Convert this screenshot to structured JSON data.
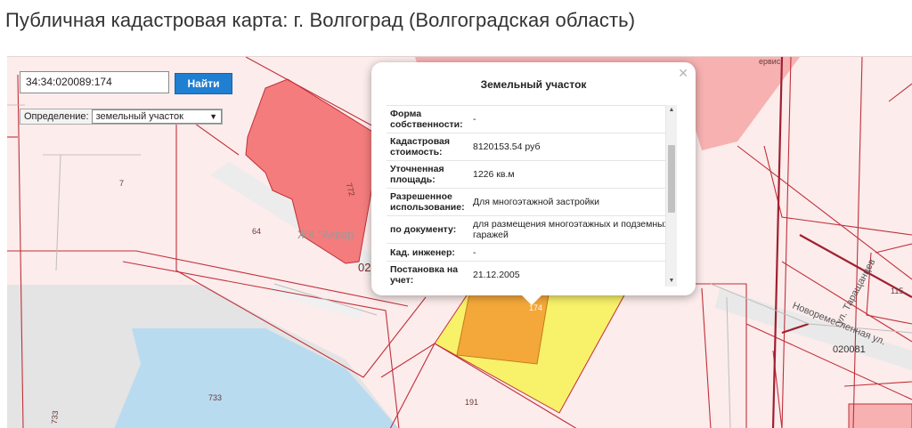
{
  "page": {
    "title": "Публичная кадастровая карта: г. Волгоград (Волгоградская область)"
  },
  "search": {
    "value": "34:34:020089:174",
    "button_label": "Найти"
  },
  "definition": {
    "label": "Определение:",
    "selected": "земельный участок"
  },
  "map_labels": {
    "parcel_7": "7",
    "parcel_772": "772",
    "parcel_64": "64",
    "zhk": "ЖК \"Аквар",
    "quarter_02": "02",
    "parcel_733": "733",
    "parcel_733_b": "733",
    "parcel_191": "191",
    "parcel_174": "174",
    "parcel_115": "115",
    "quarter_020081": "020081",
    "street_tarashchantsev": "ул. Таращанцев",
    "street_novoremeslennaya": "Новоремесленная ул.",
    "top_service": "ервис"
  },
  "popup": {
    "title": "Земельный участок",
    "close_icon": "close-icon",
    "rows": [
      {
        "key": "Форма собственности:",
        "value": "-"
      },
      {
        "key": "Кадастровая стоимость:",
        "value": "8120153.54 руб"
      },
      {
        "key": "Уточненная площадь:",
        "value": "1226 кв.м"
      },
      {
        "key": "Разрешенное использование:",
        "value": "Для многоэтажной застройки"
      },
      {
        "key": "по документу:",
        "value": "для размещения многоэтажных и подземных гаражей"
      },
      {
        "key": "Кад. инженер:",
        "value": "-"
      },
      {
        "key": "Постановка на учет:",
        "value": "21.12.2005"
      }
    ]
  },
  "colors": {
    "parcel_fill": "#fcecec",
    "boundary": "#c0303a",
    "building_red": "#f47c7c",
    "selected_yellow": "#f8f16a",
    "selected_orange": "#f5a83a",
    "water": "#b9dbef",
    "road": "#e6e6e6",
    "accent": "#1f7fd1"
  }
}
